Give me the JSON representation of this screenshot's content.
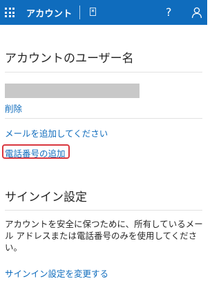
{
  "header": {
    "brand": "アカウント",
    "help_label": "?"
  },
  "username_section": {
    "title": "アカウントのユーザー名",
    "delete_link": "削除",
    "add_email_link": "メールを追加してください",
    "add_phone_link": "電話番号の追加"
  },
  "signin_section": {
    "title": "サインイン設定",
    "description": "アカウントを安全に保つために、所有しているメール アドレスまたは電話番号のみを使用してください。",
    "change_link": "サインイン設定を変更する"
  },
  "colors": {
    "header_bg": "#0f6cbd",
    "link": "#0f6cbd",
    "highlight_border": "#d9363e"
  }
}
